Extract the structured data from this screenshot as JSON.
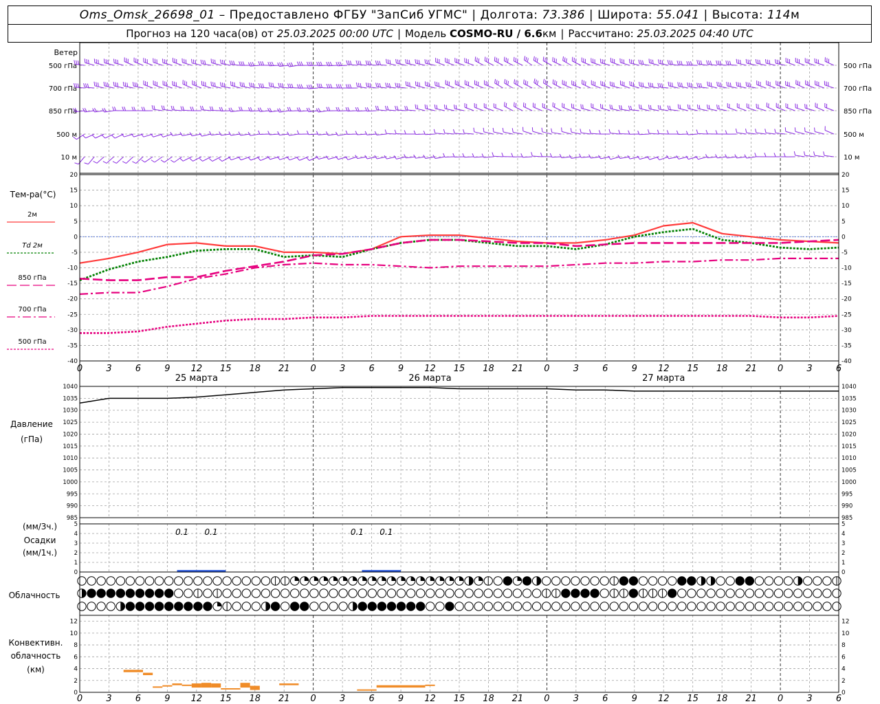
{
  "header": {
    "station": "Oms_Omsk_26698_01",
    "provided_by": "– Предоставлено ФГБУ \"ЗапСиб УГМС\"",
    "lon_label": "Долгота:",
    "lon_value": "73.386",
    "lat_label": "Широта:",
    "lat_value": "55.041",
    "alt_label": "Высота:",
    "alt_value": "114",
    "alt_unit": "м",
    "forecast_label": "Прогноз на 120 часа(ов) от",
    "forecast_start": "25.03.2025 00:00 UTC",
    "model_label": "Модель",
    "model_name": "COSMO-RU / 6.6",
    "model_unit": "км",
    "calc_label": "Рассчитано:",
    "calc_time": "25.03.2025 04:40 UTC"
  },
  "labels": {
    "wind": "Ветер",
    "wind_levels": [
      "500 гПа",
      "700 гПа",
      "850 гПа",
      "500 м",
      "10 м"
    ],
    "temp_title": "Тем-ра(°С)",
    "temp_legend": [
      "2м",
      "Td  2м",
      "850 гПа",
      "700 гПа",
      "500 гПа"
    ],
    "pressure_title": "Давление",
    "pressure_unit": "(гПа)",
    "precip_unit_top": "(мм/3ч.)",
    "precip_title": "Осадки",
    "precip_unit_bottom": "(мм/1ч.)",
    "cloud_title": "Облачность",
    "conv_title_1": "Конвективн.",
    "conv_title_2": "облачность",
    "conv_unit": "(км)"
  },
  "colors": {
    "t2m": "#ff3b3b",
    "td2m": "#008000",
    "t850": "#e6007e",
    "t700": "#e6007e",
    "t500": "#e6007e",
    "wind": "#8a2be2",
    "zero_line": "#4169e1",
    "precip": "#1f4fd8",
    "conv": "#f08c28",
    "grid": "#a0a0a0"
  },
  "chart_data": {
    "x_hour_labels": [
      "0",
      "3",
      "6",
      "9",
      "12",
      "15",
      "18",
      "21",
      "0",
      "3",
      "6",
      "9",
      "12",
      "15",
      "18",
      "21",
      "0",
      "3",
      "6",
      "9",
      "12",
      "15",
      "18",
      "21",
      "0",
      "3",
      "6"
    ],
    "day_labels": [
      "25 марта",
      "26 марта",
      "27 марта"
    ],
    "temperature": {
      "type": "line",
      "ylim": [
        -40,
        20
      ],
      "yticks": [
        "20",
        "15",
        "10",
        "5",
        "0",
        "-5",
        "-10",
        "-15",
        "-20",
        "-25",
        "-30",
        "-35",
        "-40"
      ],
      "x_hours": [
        0,
        3,
        6,
        9,
        12,
        15,
        18,
        21,
        24,
        27,
        30,
        33,
        36,
        39,
        42,
        45,
        48,
        51,
        54,
        57,
        60,
        63,
        66,
        69,
        72,
        75,
        78
      ],
      "series": [
        {
          "name": "2м",
          "values": [
            -8.5,
            -7,
            -5,
            -2.5,
            -2,
            -3,
            -3,
            -5,
            -5,
            -5.5,
            -4,
            0,
            0.5,
            0.5,
            -0.5,
            -1.5,
            -2,
            -2,
            -1,
            0.5,
            3.5,
            4.5,
            1,
            0,
            -1,
            -1.5,
            -2
          ]
        },
        {
          "name": "Td  2м",
          "values": [
            -14,
            -10.5,
            -8,
            -6.5,
            -4.5,
            -4,
            -4,
            -6.5,
            -6,
            -6.5,
            -4,
            -2,
            -1,
            -1,
            -2,
            -3,
            -3,
            -4,
            -2.5,
            0,
            1.5,
            2.5,
            -1,
            -2,
            -3.5,
            -4,
            -3.5
          ]
        },
        {
          "name": "850 гПа",
          "values": [
            -13.5,
            -14,
            -14,
            -13,
            -13,
            -11,
            -9.5,
            -8,
            -6,
            -5.5,
            -4,
            -2,
            -1,
            -1,
            -1.5,
            -2,
            -2,
            -3,
            -2.5,
            -2,
            -2,
            -2,
            -2,
            -2,
            -2,
            -1.5,
            -1
          ]
        },
        {
          "name": "700 гПа",
          "values": [
            -18.5,
            -18,
            -18,
            -16,
            -13.5,
            -12,
            -10,
            -9,
            -8.5,
            -9,
            -9,
            -9.5,
            -10,
            -9.5,
            -9.5,
            -9.5,
            -9.5,
            -9,
            -8.5,
            -8.5,
            -8,
            -8,
            -7.5,
            -7.5,
            -7,
            -7,
            -7
          ]
        },
        {
          "name": "500 гПа",
          "values": [
            -31,
            -31,
            -30.5,
            -29,
            -28,
            -27,
            -26.5,
            -26.5,
            -26,
            -26,
            -25.5,
            -25.5,
            -25.5,
            -25.5,
            -25.5,
            -25.5,
            -25.5,
            -25.5,
            -25.5,
            -25.5,
            -25.5,
            -25.5,
            -25.5,
            -25.5,
            -26,
            -26,
            -25.5
          ]
        }
      ]
    },
    "pressure": {
      "type": "line",
      "ylim": [
        985,
        1040
      ],
      "yticks": [
        "1040",
        "1035",
        "1030",
        "1025",
        "1020",
        "1015",
        "1010",
        "1005",
        "1000",
        "995",
        "990",
        "985"
      ],
      "x_hours": [
        0,
        3,
        6,
        9,
        12,
        15,
        18,
        21,
        24,
        27,
        30,
        33,
        36,
        39,
        42,
        45,
        48,
        51,
        54,
        57,
        60,
        63,
        66,
        69,
        72,
        75,
        78
      ],
      "values": [
        1033,
        1035,
        1035,
        1035,
        1035.5,
        1036.5,
        1037.5,
        1038.5,
        1039,
        1039.5,
        1039.5,
        1039.5,
        1039.5,
        1039,
        1039,
        1039,
        1039,
        1038.5,
        1038.5,
        1038,
        1038,
        1038,
        1038,
        1038,
        1038,
        1038,
        1038
      ]
    },
    "precipitation": {
      "type": "bar",
      "ylim": [
        0,
        5
      ],
      "yticks": [
        "5",
        "4",
        "3",
        "2",
        "1",
        "0"
      ],
      "annotations": [
        {
          "hour": 10.5,
          "text": "0.1"
        },
        {
          "hour": 13.5,
          "text": "0.1"
        },
        {
          "hour": 28.5,
          "text": "0.1"
        },
        {
          "hour": 31.5,
          "text": "0.1"
        }
      ],
      "bars": [
        {
          "start": 10,
          "end": 13,
          "value": 0.1
        },
        {
          "start": 13,
          "end": 15,
          "value": 0.1
        },
        {
          "start": 29,
          "end": 33,
          "value": 0.1
        }
      ]
    },
    "cloudiness": {
      "type": "table",
      "rows": [
        {
          "name": "upper",
          "cells": [
            [
              0,
              0
            ],
            [
              20,
              1
            ],
            [
              22,
              2
            ],
            [
              40,
              3
            ],
            [
              41,
              2
            ],
            [
              42,
              1
            ],
            [
              43,
              0
            ],
            [
              44,
              4
            ],
            [
              45,
              2
            ],
            [
              46,
              4
            ],
            [
              47,
              3
            ],
            [
              48,
              0
            ],
            [
              55,
              1
            ],
            [
              56,
              4
            ],
            [
              58,
              0
            ],
            [
              62,
              4
            ],
            [
              64,
              3
            ],
            [
              66,
              0
            ],
            [
              68,
              4
            ],
            [
              70,
              0
            ],
            [
              74,
              3
            ],
            [
              75,
              0
            ],
            [
              78,
              1
            ]
          ]
        },
        {
          "name": "middle",
          "cells": [
            [
              0,
              3
            ],
            [
              1,
              4
            ],
            [
              10,
              0
            ],
            [
              12,
              1
            ],
            [
              13,
              0
            ],
            [
              14,
              1
            ],
            [
              15,
              0
            ],
            [
              48,
              1
            ],
            [
              50,
              4
            ],
            [
              54,
              0
            ],
            [
              55,
              1
            ],
            [
              57,
              4
            ],
            [
              58,
              1
            ],
            [
              61,
              4
            ],
            [
              62,
              0
            ],
            [
              78,
              0
            ]
          ]
        },
        {
          "name": "low",
          "cells": [
            [
              0,
              0
            ],
            [
              4,
              3
            ],
            [
              5,
              4
            ],
            [
              14,
              2
            ],
            [
              15,
              1
            ],
            [
              16,
              0
            ],
            [
              19,
              3
            ],
            [
              20,
              4
            ],
            [
              21,
              0
            ],
            [
              22,
              4
            ],
            [
              24,
              0
            ],
            [
              28,
              3
            ],
            [
              29,
              4
            ],
            [
              36,
              0
            ],
            [
              38,
              4
            ],
            [
              39,
              0
            ],
            [
              78,
              0
            ]
          ]
        }
      ]
    },
    "convective": {
      "type": "bar",
      "ylim": [
        0,
        13
      ],
      "yticks": [
        "12",
        "10",
        "8",
        "6",
        "4",
        "2",
        "0"
      ],
      "bars": [
        {
          "start": 4.5,
          "end": 6.5,
          "top": 3.8,
          "bottom": 3.4
        },
        {
          "start": 6.5,
          "end": 7.5,
          "top": 3.3,
          "bottom": 2.9
        },
        {
          "start": 7.5,
          "end": 8.5,
          "top": 1.0,
          "bottom": 0.9
        },
        {
          "start": 8.5,
          "end": 9.5,
          "top": 1.2,
          "bottom": 1.0
        },
        {
          "start": 9.5,
          "end": 10.5,
          "top": 1.5,
          "bottom": 1.2
        },
        {
          "start": 10.5,
          "end": 11.5,
          "top": 1.3,
          "bottom": 1.1
        },
        {
          "start": 11.5,
          "end": 12.5,
          "top": 1.5,
          "bottom": 0.8
        },
        {
          "start": 12.5,
          "end": 13.5,
          "top": 1.6,
          "bottom": 0.8
        },
        {
          "start": 13.5,
          "end": 14.5,
          "top": 1.5,
          "bottom": 0.8
        },
        {
          "start": 14.5,
          "end": 16.5,
          "top": 0.7,
          "bottom": 0.5
        },
        {
          "start": 16.5,
          "end": 17.5,
          "top": 1.6,
          "bottom": 0.8
        },
        {
          "start": 17.5,
          "end": 18.5,
          "top": 1.1,
          "bottom": 0.4
        },
        {
          "start": 20.5,
          "end": 22.5,
          "top": 1.5,
          "bottom": 1.2
        },
        {
          "start": 28.5,
          "end": 30.5,
          "top": 0.5,
          "bottom": 0.4
        },
        {
          "start": 30.5,
          "end": 35.5,
          "top": 1.2,
          "bottom": 0.8
        },
        {
          "start": 35.5,
          "end": 36.5,
          "top": 1.3,
          "bottom": 1.1
        }
      ]
    },
    "wind": {
      "type": "scatter",
      "levels": [
        "500 гПа",
        "700 гПа",
        "850 гПа",
        "500 м",
        "10 м"
      ],
      "direction_deg": [
        [
          280,
          285,
          290,
          290,
          285,
          280,
          270,
          265,
          265,
          270,
          275,
          280,
          285,
          290,
          295,
          300,
          300,
          295,
          290,
          285,
          280,
          275,
          275,
          280,
          285,
          290,
          290
        ],
        [
          275,
          280,
          285,
          290,
          290,
          285,
          280,
          275,
          270,
          270,
          275,
          280,
          285,
          290,
          295,
          300,
          300,
          295,
          290,
          285,
          280,
          280,
          280,
          285,
          290,
          290,
          290
        ],
        [
          260,
          265,
          270,
          275,
          275,
          270,
          265,
          265,
          265,
          265,
          270,
          275,
          280,
          285,
          290,
          295,
          295,
          290,
          285,
          280,
          280,
          280,
          285,
          290,
          290,
          290,
          290
        ],
        [
          240,
          245,
          250,
          255,
          260,
          260,
          265,
          265,
          265,
          265,
          265,
          270,
          270,
          275,
          280,
          285,
          285,
          280,
          275,
          270,
          270,
          270,
          270,
          275,
          280,
          285,
          290
        ],
        [
          220,
          225,
          230,
          235,
          240,
          245,
          250,
          250,
          250,
          255,
          255,
          260,
          260,
          265,
          270,
          270,
          270,
          265,
          260,
          255,
          255,
          255,
          260,
          265,
          270,
          275,
          280
        ]
      ]
    }
  }
}
